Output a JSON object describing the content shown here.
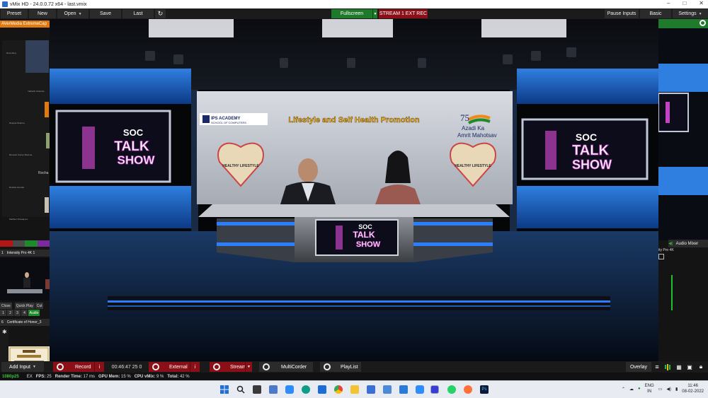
{
  "window": {
    "title": "vMix HD - 24.0.0.72 x64 - last.vmix",
    "controls": [
      "–",
      "□",
      "✕"
    ]
  },
  "toolbar": {
    "preset": "Preset",
    "new": "New",
    "open": "Open",
    "save": "Save",
    "last": "Last",
    "refresh_icon": "refresh-icon",
    "fullscreen": "Fullscreen",
    "stream1": "STREAM 1",
    "ext": "EXT",
    "rec": "REC",
    "pause_inputs": "Pause Inputs",
    "basic": "Basic",
    "settings": "Settings"
  },
  "left_panel": {
    "camera_header": "AVerMedia ExtremeCap",
    "gallery_labels": [
      "Recording",
      "Yatharth Chandra",
      "Deepak Sharma",
      "Ramesh Kumar Sharma",
      "Sudeep Patel",
      "Rocha",
      "Roshan Gouhar",
      "Vivek Kumar Tiwari",
      "Madhuri Khanapure"
    ],
    "input1": {
      "number": "1",
      "name": "Intensity Pro 4K 1"
    },
    "input1_buttons": [
      "Close",
      "Quick Play",
      "Cut"
    ],
    "input1_numbers": [
      "1",
      "2",
      "3",
      "4"
    ],
    "input1_audio": "Audio",
    "input6": {
      "number": "6",
      "name": "Certificate of Honor_3"
    }
  },
  "output": {
    "scene": {
      "logo_line1": "IPS ACADEMY",
      "logo_line2": "SCHOOL OF COMPUTERS",
      "headline": "Lifestyle and Self Health Promotion",
      "azadi_number": "75",
      "azadi_line1": "Azadi Ka",
      "azadi_line2": "Amrit Mahotsav",
      "healthy_left": "HEALTHY LIFESTYLE",
      "healthy_right": "HEALTHY LIFESTYLE",
      "show_soc": "SOC",
      "show_talk": "TALK",
      "show_show": "SHOW"
    }
  },
  "right_panel": {
    "preview_label": "ity Pro 4K",
    "audio_mixer": "Audio Mixer"
  },
  "bottom_bar": {
    "add_input": "Add Input",
    "record": "Record",
    "timecode": "00:46:47 25 0",
    "external": "External",
    "stream": "Stream",
    "multicorder": "MultiCorder",
    "playlist": "PlayList",
    "overlay": "Overlay"
  },
  "status": {
    "resolution": "1080p25",
    "ex": "EX",
    "fps_label": "FPS:",
    "fps": "25",
    "render_label": "Render Time:",
    "render": "17 ms",
    "gpu_label": "GPU Mem:",
    "gpu": "15 %",
    "cpu_label": "CPU vMix:",
    "cpu": "9 %",
    "total_label": "Total:",
    "total": "42 %"
  },
  "taskbar": {
    "lang1": "ENG",
    "lang2": "IN",
    "time": "11:46",
    "date": "08-02-2022",
    "icons": [
      "windows-start-icon",
      "search-icon",
      "task-view-icon",
      "widgets-icon",
      "file-explorer-icon",
      "zoom-icon",
      "edge-icon",
      "mail-icon",
      "chrome-icon",
      "folder-icon",
      "calendar-icon",
      "store-icon",
      "zoom2-icon",
      "app-icon",
      "whatsapp-icon",
      "firefox-icon",
      "photoshop-icon"
    ]
  },
  "colors": {
    "accent_green": "#1e7a2a",
    "record_red": "#8a0f16",
    "stream_red": "#8a0f16",
    "status_green": "#3fc43f"
  }
}
